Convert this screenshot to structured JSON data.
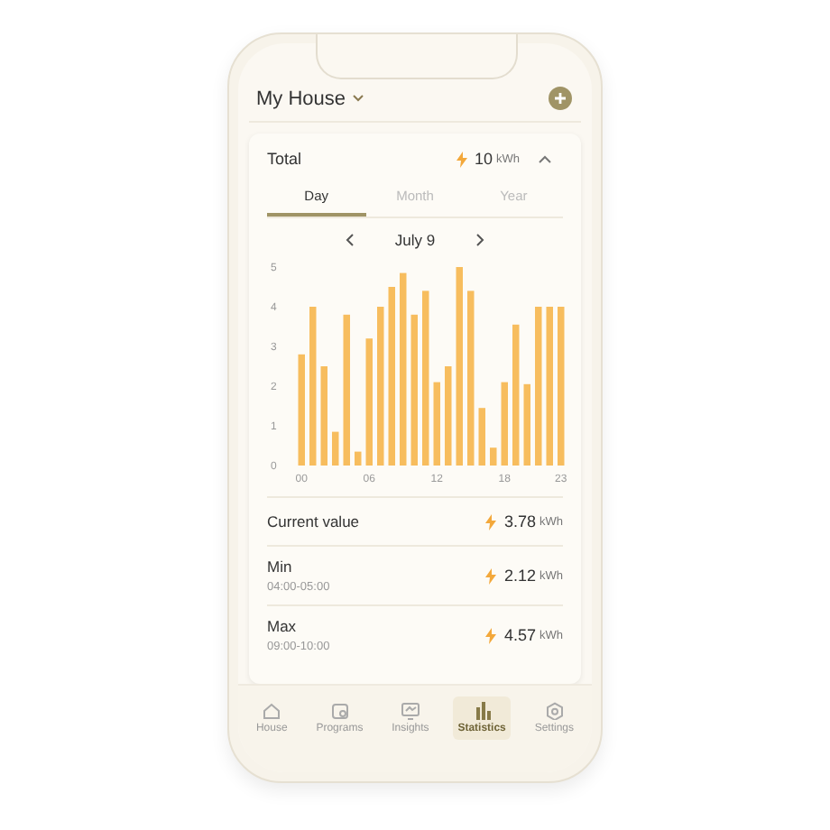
{
  "header": {
    "title": "My House"
  },
  "total": {
    "label": "Total",
    "value": "10",
    "unit": "kWh",
    "expanded": true
  },
  "tabs": [
    {
      "label": "Day",
      "selected": true
    },
    {
      "label": "Month",
      "selected": false
    },
    {
      "label": "Year",
      "selected": false
    }
  ],
  "date": {
    "label": "July 9"
  },
  "chart_data": {
    "type": "bar",
    "x": [
      0,
      1,
      2,
      3,
      4,
      5,
      6,
      7,
      8,
      9,
      10,
      11,
      12,
      13,
      14,
      15,
      16,
      17,
      18,
      19,
      20,
      21,
      22,
      23
    ],
    "xlim": [
      -0.5,
      23.5
    ],
    "series": [
      {
        "color": "#f7bd5e",
        "values": [
          2.8,
          4.0,
          2.5,
          0.85,
          3.8,
          0.35,
          3.2,
          4.0,
          4.5,
          4.85,
          3.8,
          4.4,
          2.1,
          2.5,
          5.0,
          4.4,
          1.45,
          0.45,
          2.1,
          3.55,
          2.05,
          4.0,
          4.0,
          4.0
        ]
      }
    ],
    "ylim": [
      0,
      5
    ],
    "yticks": [
      0,
      1,
      2,
      3,
      4,
      5
    ],
    "xticks": [
      {
        "value": 0,
        "label": "00"
      },
      {
        "value": 6,
        "label": "06"
      },
      {
        "value": 12,
        "label": "12"
      },
      {
        "value": 18,
        "label": "18"
      },
      {
        "value": 23,
        "label": "23"
      }
    ]
  },
  "stats": [
    {
      "label": "Current value",
      "value": "3.78",
      "unit": "kWh"
    },
    {
      "label": "Min",
      "time": "04:00-05:00",
      "value": "2.12",
      "unit": "kWh"
    },
    {
      "label": "Max",
      "time": "09:00-10:00",
      "value": "4.57",
      "unit": "kWh"
    }
  ],
  "nav": [
    {
      "label": "House",
      "selected": false
    },
    {
      "label": "Programs",
      "selected": false
    },
    {
      "label": "Insights",
      "selected": false
    },
    {
      "label": "Statistics",
      "selected": true
    },
    {
      "label": "Settings",
      "selected": false
    }
  ]
}
